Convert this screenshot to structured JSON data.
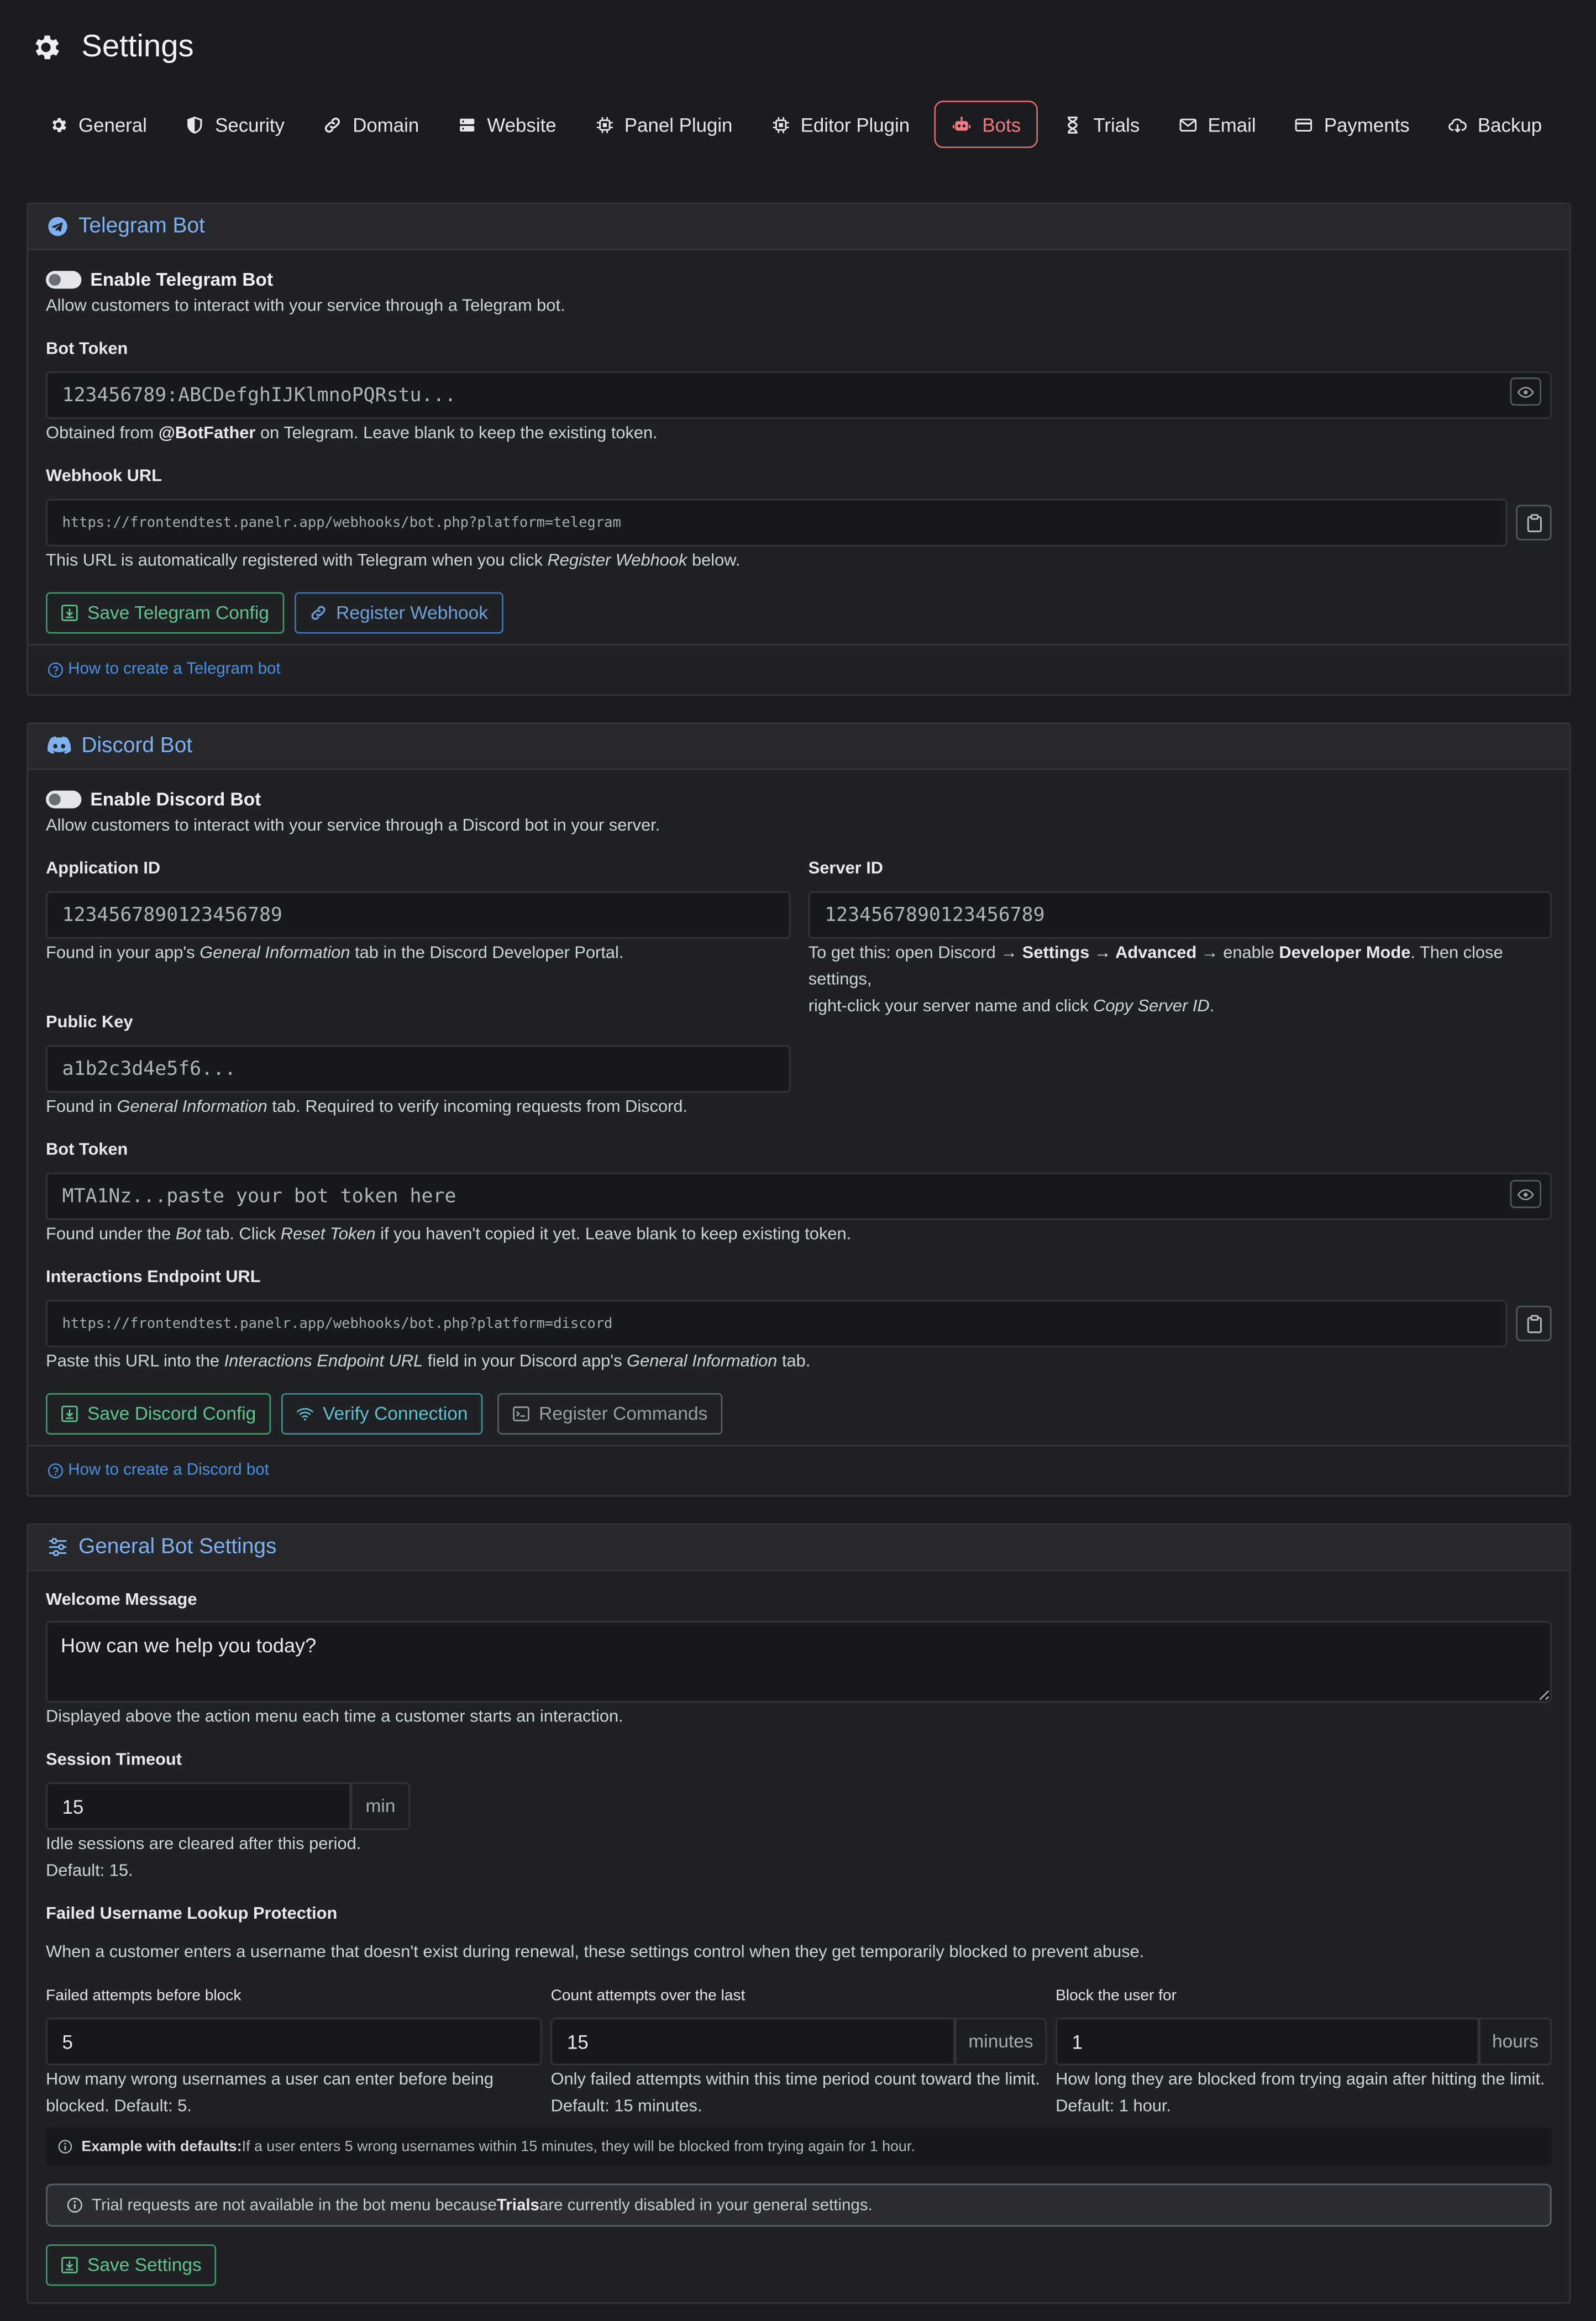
{
  "page": {
    "title": "Settings"
  },
  "tabs": [
    {
      "label": "General"
    },
    {
      "label": "Security"
    },
    {
      "label": "Domain"
    },
    {
      "label": "Website"
    },
    {
      "label": "Panel Plugin"
    },
    {
      "label": "Editor Plugin"
    },
    {
      "label": "Bots"
    },
    {
      "label": "Trials"
    },
    {
      "label": "Email"
    },
    {
      "label": "Payments"
    },
    {
      "label": "Backup"
    }
  ],
  "active_tab": "Bots",
  "colors": {
    "accent": "#e0656c",
    "card_title": "#7fb0ef",
    "success": "#62c38e",
    "link": "#4a8fe0"
  },
  "telegram": {
    "title": "Telegram Bot",
    "enable_label": "Enable Telegram Bot",
    "enabled": false,
    "enable_help": "Allow customers to interact with your service through a Telegram bot.",
    "token_label": "Bot Token",
    "token_placeholder": "123456789:ABCDefghIJKlmnoPQRstu...",
    "token_help_pre": "Obtained from ",
    "token_help_bold": "@BotFather",
    "token_help_post": " on Telegram. Leave blank to keep the existing token.",
    "webhook_label": "Webhook URL",
    "webhook_value": "https://frontendtest.panelr.app/webhooks/bot.php?platform=telegram",
    "webhook_help_pre": "This URL is automatically registered with Telegram when you click ",
    "webhook_help_em": "Register Webhook",
    "webhook_help_post": " below.",
    "save_button": "Save Telegram Config",
    "register_button": "Register Webhook",
    "howto_link": "How to create a Telegram bot"
  },
  "discord": {
    "title": "Discord Bot",
    "enable_label": "Enable Discord Bot",
    "enabled": false,
    "enable_help": "Allow customers to interact with your service through a Discord bot in your server.",
    "app_id_label": "Application ID",
    "app_id_placeholder": "1234567890123456789",
    "app_id_help_pre": "Found in your app's ",
    "app_id_help_em": "General Information",
    "app_id_help_post": " tab in the Discord Developer Portal.",
    "server_id_label": "Server ID",
    "server_id_placeholder": "1234567890123456789",
    "server_help_1": "To get this: open Discord → ",
    "server_help_2": "Settings → Advanced",
    "server_help_3": " → enable ",
    "server_help_4": "Developer Mode",
    "server_help_5": ". Then close settings,",
    "server_help_6": "right-click your server name and click ",
    "server_help_7": "Copy Server ID",
    "server_help_8": ".",
    "pubkey_label": "Public Key",
    "pubkey_placeholder": "a1b2c3d4e5f6...",
    "pubkey_help_pre": "Found in ",
    "pubkey_help_em": "General Information",
    "pubkey_help_post": " tab. Required to verify incoming requests from Discord.",
    "token_label": "Bot Token",
    "token_placeholder": "MTA1Nz...paste your bot token here",
    "token_help_1": "Found under the ",
    "token_help_2": "Bot",
    "token_help_3": " tab. Click ",
    "token_help_4": "Reset Token",
    "token_help_5": " if you haven't copied it yet. Leave blank to keep existing token.",
    "endpoint_label": "Interactions Endpoint URL",
    "endpoint_value": "https://frontendtest.panelr.app/webhooks/bot.php?platform=discord",
    "endpoint_help_1": "Paste this URL into the ",
    "endpoint_help_2": "Interactions Endpoint URL",
    "endpoint_help_3": " field in your Discord app's ",
    "endpoint_help_4": "General Information",
    "endpoint_help_5": " tab.",
    "save_button": "Save Discord Config",
    "verify_button": "Verify Connection",
    "commands_button": "Register Commands",
    "howto_link": "How to create a Discord bot"
  },
  "general": {
    "title": "General Bot Settings",
    "welcome_label": "Welcome Message",
    "welcome_value": "How can we help you today?",
    "welcome_help": "Displayed above the action menu each time a customer starts an interaction.",
    "timeout_label": "Session Timeout",
    "timeout_value": "15",
    "timeout_unit": "min",
    "timeout_help_1": "Idle sessions are cleared after this period.",
    "timeout_help_2": "Default: 15.",
    "protection_title": "Failed Username Lookup Protection",
    "protection_help": "When a customer enters a username that doesn't exist during renewal, these settings control when they get temporarily blocked to prevent abuse.",
    "attempts_label": "Failed attempts before block",
    "attempts_value": "5",
    "attempts_help_1": "How many wrong usernames a user can enter before being",
    "attempts_help_2": "blocked. Default: 5.",
    "window_label": "Count attempts over the last",
    "window_value": "15",
    "window_unit": "minutes",
    "window_help_1": "Only failed attempts within this time period count toward the limit.",
    "window_help_2": "Default: 15 minutes.",
    "block_label": "Block the user for",
    "block_value": "1",
    "block_unit": "hours",
    "block_help_1": "How long they are blocked from trying again after hitting the limit.",
    "block_help_2": "Default: 1 hour.",
    "example_bold": "Example with defaults:",
    "example_text": " If a user enters 5 wrong usernames within 15 minutes, they will be blocked from trying again for 1 hour.",
    "trial_alert_pre": "Trial requests are not available in the bot menu because ",
    "trial_alert_bold": "Trials",
    "trial_alert_post": " are currently disabled in your general settings.",
    "save_button": "Save Settings"
  }
}
